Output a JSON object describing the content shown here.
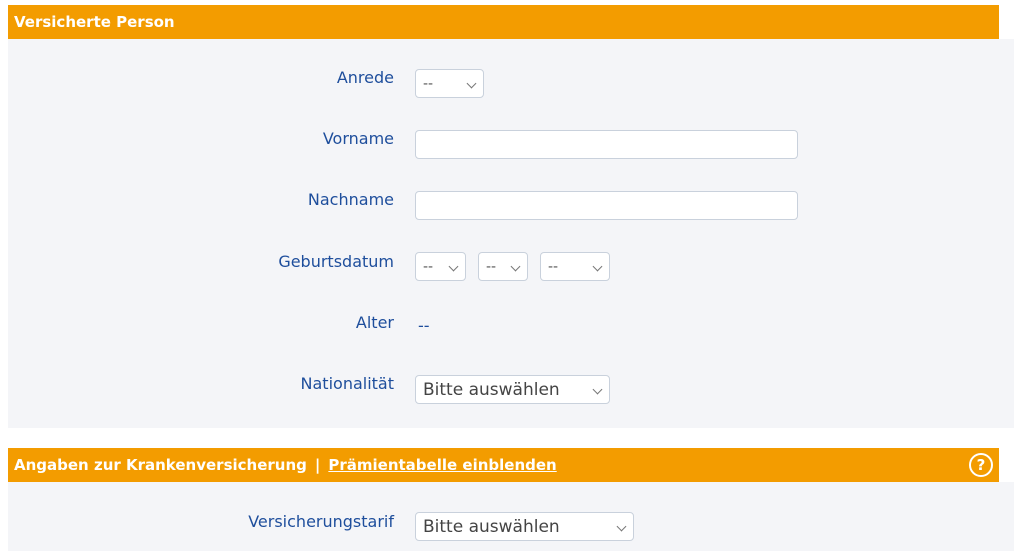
{
  "section1": {
    "title": "Versicherte Person",
    "anrede": {
      "label": "Anrede",
      "value": "--"
    },
    "vorname": {
      "label": "Vorname",
      "value": ""
    },
    "nachname": {
      "label": "Nachname",
      "value": ""
    },
    "geburtsdatum": {
      "label": "Geburtsdatum",
      "day": "--",
      "month": "--",
      "year": "--"
    },
    "alter": {
      "label": "Alter",
      "value": "--"
    },
    "nationalitaet": {
      "label": "Nationalität",
      "value": "Bitte auswählen"
    }
  },
  "section2": {
    "title": "Angaben zur Krankenversicherung",
    "separator": "|",
    "link": "Prämientabelle einblenden",
    "help_icon": "?",
    "tarif": {
      "label": "Versicherungstarif",
      "value": "Bitte auswählen"
    }
  },
  "colors": {
    "header": "#f39c00",
    "label": "#1e4e9c",
    "body_bg": "#f4f5f8"
  }
}
